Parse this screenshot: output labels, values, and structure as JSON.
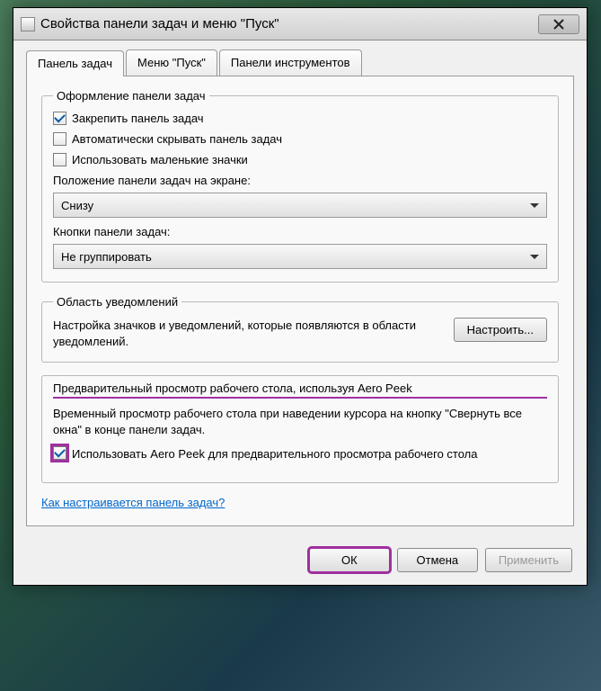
{
  "title": "Свойства панели задач и меню \"Пуск\"",
  "tabs": {
    "taskbar": "Панель задач",
    "startmenu": "Меню \"Пуск\"",
    "toolbars": "Панели инструментов"
  },
  "appearance": {
    "legend": "Оформление панели задач",
    "lock": "Закрепить панель задач",
    "autohide": "Автоматически скрывать панель задач",
    "smallicons": "Использовать маленькие значки",
    "position_label": "Положение панели задач на экране:",
    "position_value": "Снизу",
    "buttons_label": "Кнопки панели задач:",
    "buttons_value": "Не группировать"
  },
  "notif": {
    "legend": "Область уведомлений",
    "text": "Настройка значков и уведомлений, которые появляются в области уведомлений.",
    "configure": "Настроить..."
  },
  "aero": {
    "title": "Предварительный просмотр рабочего стола, используя Aero Peek",
    "desc": "Временный просмотр рабочего стола при наведении курсора на кнопку \"Свернуть все окна\" в конце панели задач.",
    "check": "Использовать Aero Peek для предварительного просмотра рабочего стола"
  },
  "link": "Как настраивается панель задач?",
  "buttons": {
    "ok": "ОК",
    "cancel": "Отмена",
    "apply": "Применить"
  }
}
